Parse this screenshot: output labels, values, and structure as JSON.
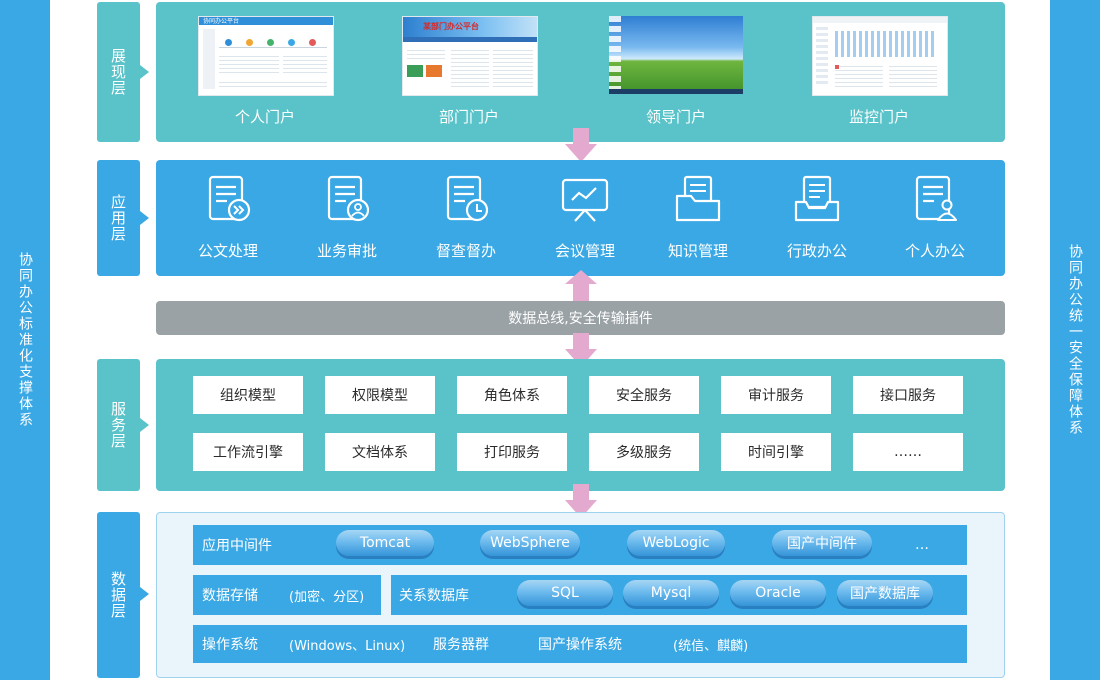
{
  "left_bar": {
    "label": "协同办公标准化支撑体系"
  },
  "right_bar": {
    "label": "协同办公统一安全保障体系"
  },
  "layers": {
    "presentation": {
      "label": "展现层",
      "portals": [
        {
          "label": "个人门户",
          "screen_title": "协同办公平台"
        },
        {
          "label": "部门门户",
          "screen_title": "某部门办公平台"
        },
        {
          "label": "领导门户"
        },
        {
          "label": "监控门户"
        }
      ]
    },
    "application": {
      "label": "应用层",
      "apps": [
        {
          "label": "公文处理",
          "icon": "document-forward-icon"
        },
        {
          "label": "业务审批",
          "icon": "document-user-icon"
        },
        {
          "label": "督查督办",
          "icon": "document-clock-icon"
        },
        {
          "label": "会议管理",
          "icon": "presentation-board-icon"
        },
        {
          "label": "知识管理",
          "icon": "folder-document-icon"
        },
        {
          "label": "行政办公",
          "icon": "inbox-tray-icon"
        },
        {
          "label": "个人办公",
          "icon": "document-person-icon"
        }
      ]
    },
    "bus": {
      "label": "数据总线,安全传输插件"
    },
    "service": {
      "label": "服务层",
      "items": [
        "组织模型",
        "权限模型",
        "角色体系",
        "安全服务",
        "审计服务",
        "接口服务",
        "工作流引擎",
        "文档体系",
        "打印服务",
        "多级服务",
        "时间引擎",
        "……"
      ]
    },
    "data": {
      "label": "数据层",
      "middleware": {
        "label": "应用中间件",
        "items": [
          "Tomcat",
          "WebSphere",
          "WebLogic",
          "国产中间件"
        ],
        "more": "…"
      },
      "storage": {
        "label": "数据存储",
        "note": "(加密、分区)"
      },
      "rdb": {
        "label": "关系数据库",
        "items": [
          "SQL",
          "Mysql",
          "Oracle",
          "国产数据库"
        ]
      },
      "os": {
        "label": "操作系统",
        "note": "(Windows、Linux)",
        "cluster": "服务器群",
        "domestic_os": "国产操作系统",
        "domestic_note": "(统信、麒麟)"
      }
    }
  },
  "colors": {
    "blue": "#3aa8e4",
    "teal": "#5ac3c9",
    "gray": "#9aa2a6",
    "arrow": "#e3a9cf"
  }
}
